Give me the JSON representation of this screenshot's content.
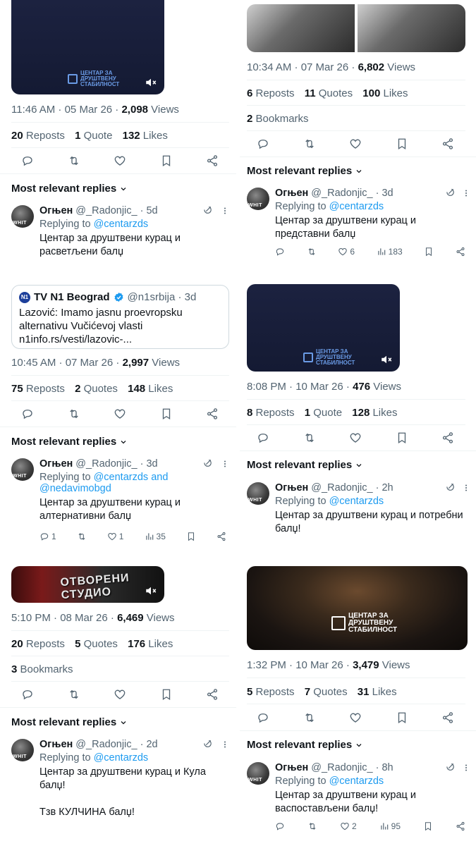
{
  "colors": {
    "text": "#0f1419",
    "muted": "#536471",
    "link": "#1d9bf0",
    "divider": "#eff3f4"
  },
  "icons": [
    "reply-icon",
    "repost-icon",
    "like-icon",
    "bookmark-icon",
    "share-icon",
    "views-icon",
    "grok-icon",
    "more-icon",
    "mute-icon",
    "chevron-down-icon",
    "verified-icon"
  ],
  "panels": [
    {
      "time": "11:46 AM · 05 Mar 26 · ",
      "views_num": "2,098",
      "views_label": " Views",
      "reposts_num": "20",
      "reposts_label": " Reposts",
      "quotes_num": "1",
      "quotes_label": " Quote",
      "likes_num": "132",
      "likes_label": " Likes",
      "media_watermark": "ЦЕНТАР ЗА ДРУШТВЕНУ СТАБИЛНОСТ",
      "replies_header": "Most relevant replies",
      "reply": {
        "name": "Огњен",
        "handle": " @_Radonjic_ · 5d",
        "to_label": "Replying to ",
        "to_link": "@centarzds",
        "text": "Центар за друштвени курац и расветљени балџ"
      }
    },
    {
      "time": "10:34 AM · 07 Mar 26 · ",
      "views_num": "6,802",
      "views_label": " Views",
      "reposts_num": "6",
      "reposts_label": " Reposts",
      "quotes_num": "11",
      "quotes_label": " Quotes",
      "likes_num": "100",
      "likes_label": " Likes",
      "bookmarks_num": "2",
      "bookmarks_label": " Bookmarks",
      "replies_header": "Most relevant replies",
      "reply": {
        "name": "Огњен",
        "handle": " @_Radonjic_ · 3d",
        "to_label": "Replying to ",
        "to_link": "@centarzds",
        "text": "Центар за друштвени курац и представни балџ",
        "likes": "6",
        "views": "183"
      }
    },
    {
      "quote": {
        "logo": "N1",
        "name": "TV N1 Beograd",
        "handle": "@n1srbija · 3d",
        "text": "Lazović: Imamo jasnu proevropsku alternativu Vučićevoj vlasti n1info.rs/vesti/lazovic-..."
      },
      "time": "10:45 AM · 07 Mar 26 · ",
      "views_num": "2,997",
      "views_label": " Views",
      "reposts_num": "75",
      "reposts_label": " Reposts",
      "quotes_num": "2",
      "quotes_label": " Quotes",
      "likes_num": "148",
      "likes_label": " Likes",
      "replies_header": "Most relevant replies",
      "reply": {
        "name": "Огњен",
        "handle": " @_Radonjic_ · 3d",
        "to_label": "Replying to ",
        "to_link": "@centarzds and @nedavimobgd",
        "text": "Центар за друштвени курац и алтернативни балџ",
        "replies": "1",
        "likes": "1",
        "views": "35"
      }
    },
    {
      "media_watermark": "ЦЕНТАР ЗА ДРУШТВЕНУ СТАБИЛНОСТ",
      "time": "8:08 PM · 10 Mar 26 · ",
      "views_num": "476",
      "views_label": " Views",
      "reposts_num": "8",
      "reposts_label": " Reposts",
      "quotes_num": "1",
      "quotes_label": " Quote",
      "likes_num": "128",
      "likes_label": " Likes",
      "replies_header": "Most relevant replies",
      "reply": {
        "name": "Огњен",
        "handle": " @_Radonjic_ · 2h",
        "to_label": "Replying to ",
        "to_link": "@centarzds",
        "text": "Центар за друштвени курац и потребни балџ!"
      }
    },
    {
      "media_title": "ОТВОРЕНИ СТУДИО",
      "time": "5:10 PM · 08 Mar 26 · ",
      "views_num": "6,469",
      "views_label": " Views",
      "reposts_num": "20",
      "reposts_label": " Reposts",
      "quotes_num": "5",
      "quotes_label": " Quotes",
      "likes_num": "176",
      "likes_label": " Likes",
      "bookmarks_num": "3",
      "bookmarks_label": " Bookmarks",
      "replies_header": "Most relevant replies",
      "reply": {
        "name": "Огњен",
        "handle": " @_Radonjic_ · 2d",
        "to_label": "Replying to ",
        "to_link": "@centarzds",
        "text": "Центар за друштвени курац и Кула балџ!",
        "text2": "Тзв КУЛЧИНА балџ!"
      }
    },
    {
      "media_watermark": "ЦЕНТАР ЗА ДРУШТВЕНУ СТАБИЛНОСТ",
      "time": "1:32 PM · 10 Mar 26 · ",
      "views_num": "3,479",
      "views_label": " Views",
      "reposts_num": "5",
      "reposts_label": " Reposts",
      "quotes_num": "7",
      "quotes_label": " Quotes",
      "likes_num": "31",
      "likes_label": " Likes",
      "replies_header": "Most relevant replies",
      "reply": {
        "name": "Огњен",
        "handle": " @_Radonjic_ · 8h",
        "to_label": "Replying to ",
        "to_link": "@centarzds",
        "text": "Центар за друштвени курац и васпостављени балџ!",
        "likes": "2",
        "views": "95"
      }
    }
  ]
}
